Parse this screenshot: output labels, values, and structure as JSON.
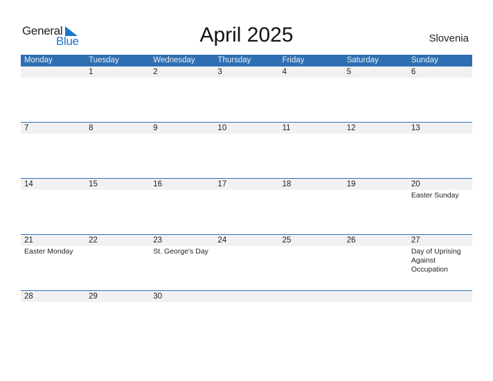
{
  "logo": {
    "general": "General",
    "blue": "Blue"
  },
  "title": "April 2025",
  "country": "Slovenia",
  "weekdays": [
    "Monday",
    "Tuesday",
    "Wednesday",
    "Thursday",
    "Friday",
    "Saturday",
    "Sunday"
  ],
  "weeks": [
    {
      "days": [
        "",
        "1",
        "2",
        "3",
        "4",
        "5",
        "6"
      ],
      "events": [
        "",
        "",
        "",
        "",
        "",
        "",
        ""
      ]
    },
    {
      "days": [
        "7",
        "8",
        "9",
        "10",
        "11",
        "12",
        "13"
      ],
      "events": [
        "",
        "",
        "",
        "",
        "",
        "",
        ""
      ]
    },
    {
      "days": [
        "14",
        "15",
        "16",
        "17",
        "18",
        "19",
        "20"
      ],
      "events": [
        "",
        "",
        "",
        "",
        "",
        "",
        "Easter Sunday"
      ]
    },
    {
      "days": [
        "21",
        "22",
        "23",
        "24",
        "25",
        "26",
        "27"
      ],
      "events": [
        "Easter Monday",
        "",
        "St. George's Day",
        "",
        "",
        "",
        "Day of Uprising Against Occupation"
      ]
    },
    {
      "days": [
        "28",
        "29",
        "30",
        "",
        "",
        "",
        ""
      ],
      "events": [
        "",
        "",
        "",
        "",
        "",
        "",
        ""
      ]
    }
  ]
}
